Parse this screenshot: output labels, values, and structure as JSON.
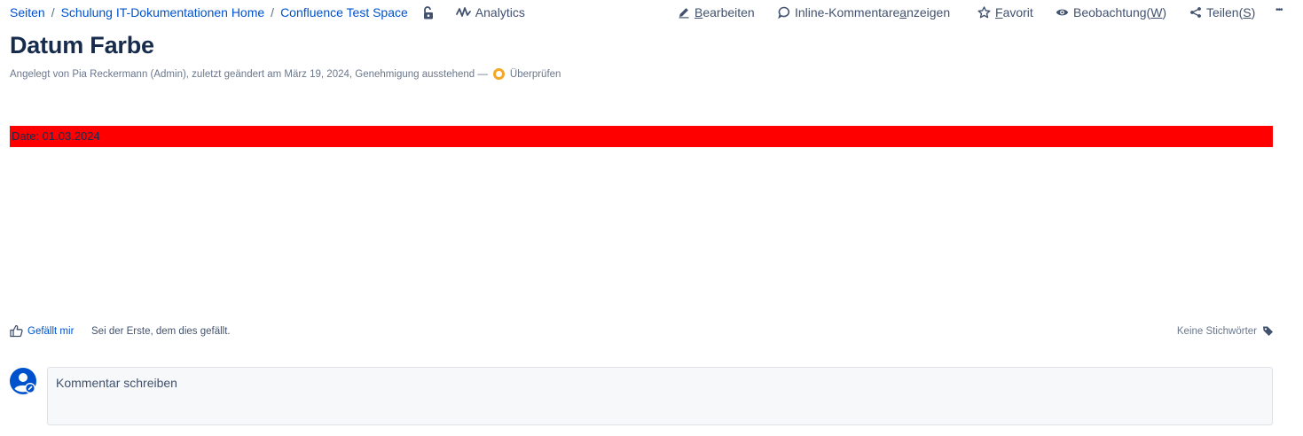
{
  "breadcrumb": {
    "items": [
      "Seiten",
      "Schulung IT-Dokumentationen Home",
      "Confluence Test Space"
    ],
    "separator": "/"
  },
  "analytics": {
    "label": "Analytics"
  },
  "actions": {
    "edit": {
      "label_prefix": "",
      "label_u": "B",
      "label_rest": "earbeiten"
    },
    "inline_comments": {
      "label_prefix": "Inline-Kommentare ",
      "label_u": "a",
      "label_rest": "nzeigen"
    },
    "favorite": {
      "label_prefix": "",
      "label_u": "F",
      "label_rest": "avorit"
    },
    "watch": {
      "label_prefix": "Beobachtung(",
      "label_u": "W",
      "label_rest": ")"
    },
    "share": {
      "label_prefix": "Teilen(",
      "label_u": "S",
      "label_rest": ")"
    },
    "more": {
      "label": "•••"
    }
  },
  "page": {
    "title": "Datum Farbe",
    "byline": "Angelegt von Pia Reckermann (Admin), zuletzt geändert am März 19, 2024, Genehmigung ausstehend —",
    "review_label": "Überprüfen",
    "content_text": "Date: 01.03.2024",
    "content_bg_color": "#ff0000"
  },
  "footer": {
    "like_label": "Gefällt mir",
    "like_text": "Sei der Erste, dem dies gefällt.",
    "tags_label": "Keine Stichwörter"
  },
  "comment": {
    "placeholder": "Kommentar schreiben"
  },
  "colors": {
    "link": "#0052cc",
    "text": "#172b4d",
    "review": "#f5a623"
  }
}
